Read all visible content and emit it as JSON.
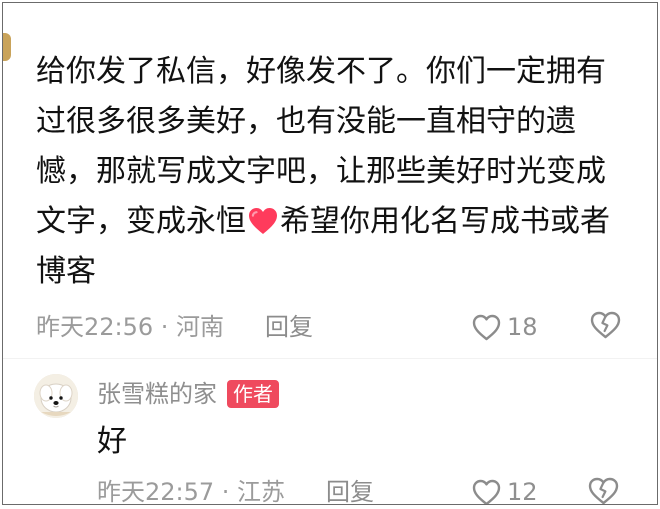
{
  "comment": {
    "text_before_emoji": "给你发了私信，好像发不了。你们一定拥有过很多很多美好，也有没能一直相守的遗憾，那就写成文字吧，让那些美好时光变成文字，变成永恒",
    "emoji": "red-heart-emoji",
    "text_after_emoji": "希望你用化名写成书或者博客",
    "meta": "昨天22:56 · 河南",
    "reply_label": "回复",
    "likes": "18"
  },
  "reply": {
    "username": "张雪糕的家",
    "badge": "作者",
    "text": "好",
    "meta": "昨天22:57 · 江苏",
    "reply_label": "回复",
    "likes": "12"
  },
  "icons": {
    "like": "heart-outline-icon",
    "dislike": "broken-heart-outline-icon",
    "avatar": "white-dog-avatar"
  },
  "colors": {
    "text": "#111111",
    "meta": "#9b9b9b",
    "badge_background": "#ef4a5e",
    "heart": "#ff3b5c",
    "border": "#6b6b6b"
  }
}
